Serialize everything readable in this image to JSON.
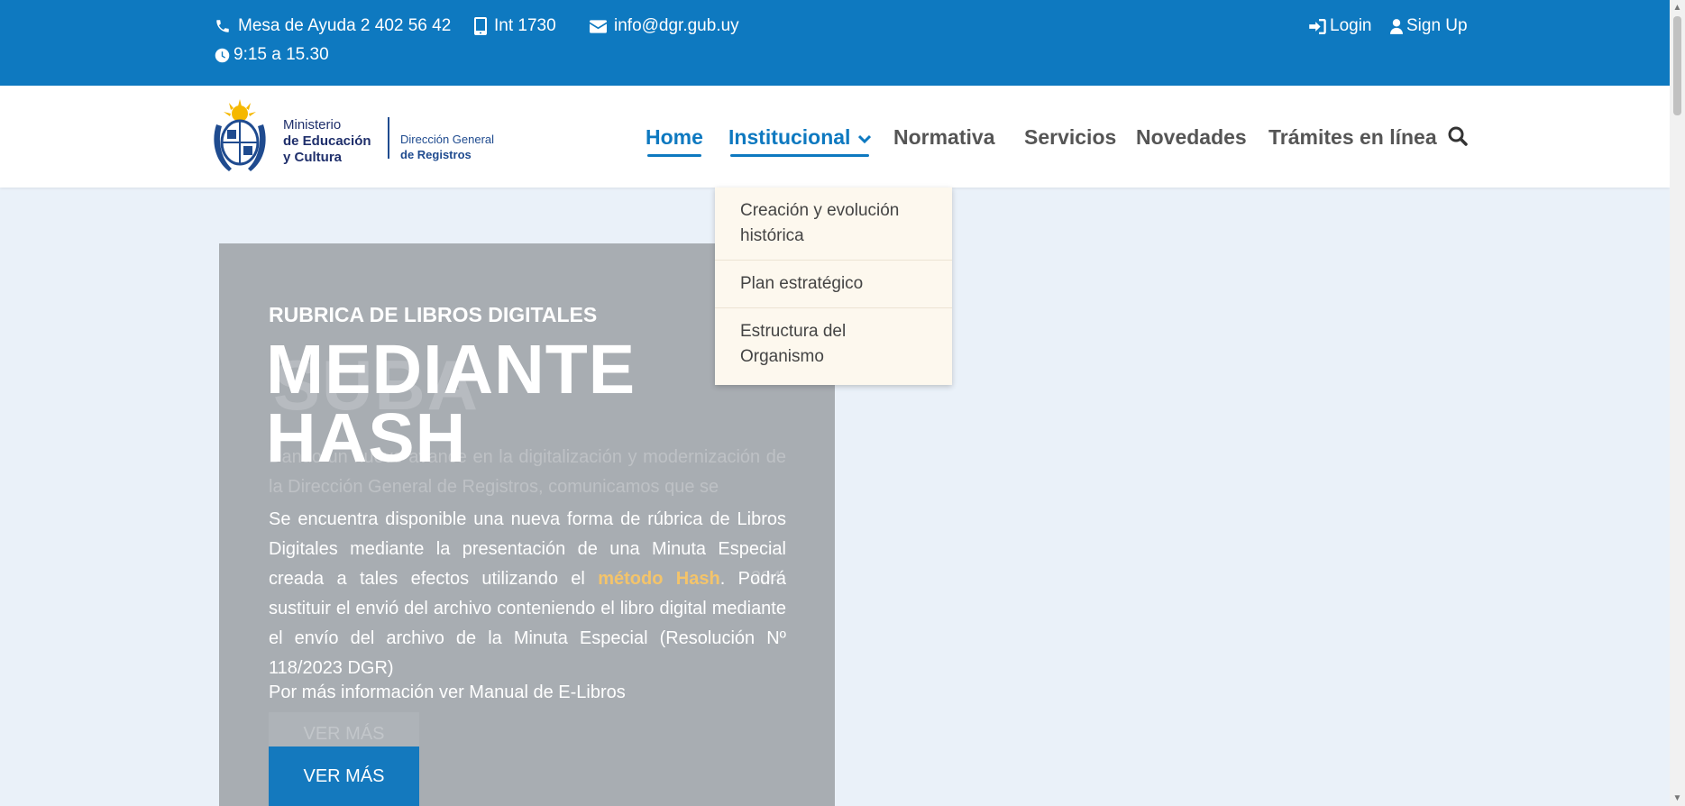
{
  "topbar": {
    "helpdesk": "Mesa de Ayuda 2 402 56 42",
    "internal": "Int 1730",
    "email": "info@dgr.gub.uy",
    "hours": "9:15 a 15.30",
    "login": "Login",
    "signup": "Sign Up"
  },
  "logo": {
    "line1": "Ministerio",
    "line2": "de Educación",
    "line3": "y Cultura",
    "line4": "Dirección General",
    "line5": "de Registros"
  },
  "nav": {
    "home": "Home",
    "institucional": "Institucional",
    "normativa": "Normativa",
    "servicios": "Servicios",
    "novedades": "Novedades",
    "tramites": "Trámites en línea"
  },
  "dropdown": {
    "items": [
      "Creación y evolución histórica",
      "Plan estratégico",
      "Estructura del Organismo"
    ]
  },
  "hero": {
    "subtitle": "RUBRICA DE LIBROS DIGITALES",
    "title_line1": "MEDIANTE",
    "title_line2": "HASH",
    "body_part1": "Se encuentra disponible una nueva forma de rúbrica de Libros Digitales mediante la presentación de una Minuta Especial creada a tales efectos utilizando el ",
    "body_highlight": "método Hash",
    "body_part2": ". Podrá sustituir el envió del archivo conteniendo el libro digital mediante el envío del archivo de la Minuta Especial (Resolución Nº 118/2023 DGR)",
    "more_info": "Por más información ver Manual de E-Libros",
    "button": "VER MÁS"
  },
  "colors": {
    "topbar": "#0e79c0",
    "accent": "#0e79c0",
    "highlight": "#f4c46a",
    "card": "#a8adb2"
  }
}
